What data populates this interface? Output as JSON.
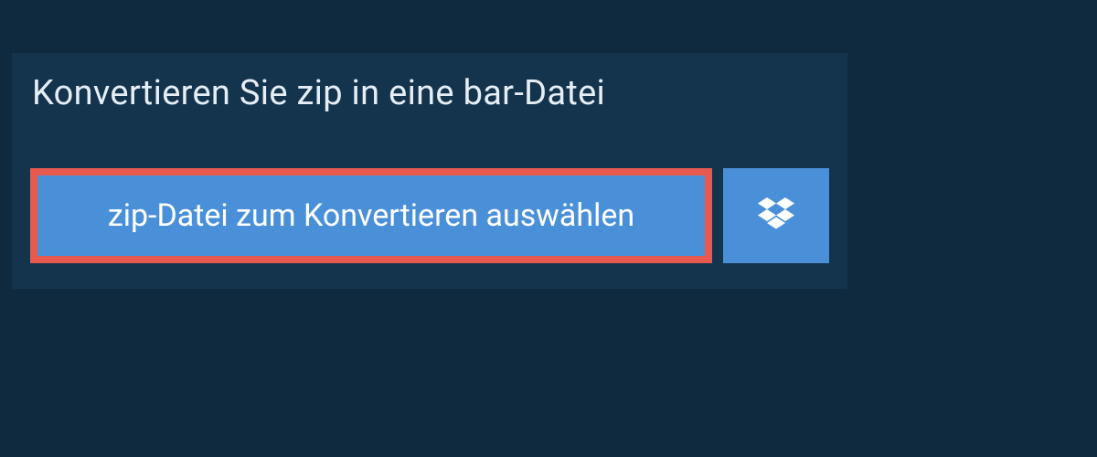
{
  "header": {
    "title": "Konvertieren Sie zip in eine bar-Datei"
  },
  "actions": {
    "select_file_label": "zip-Datei zum Konvertieren auswählen"
  }
}
